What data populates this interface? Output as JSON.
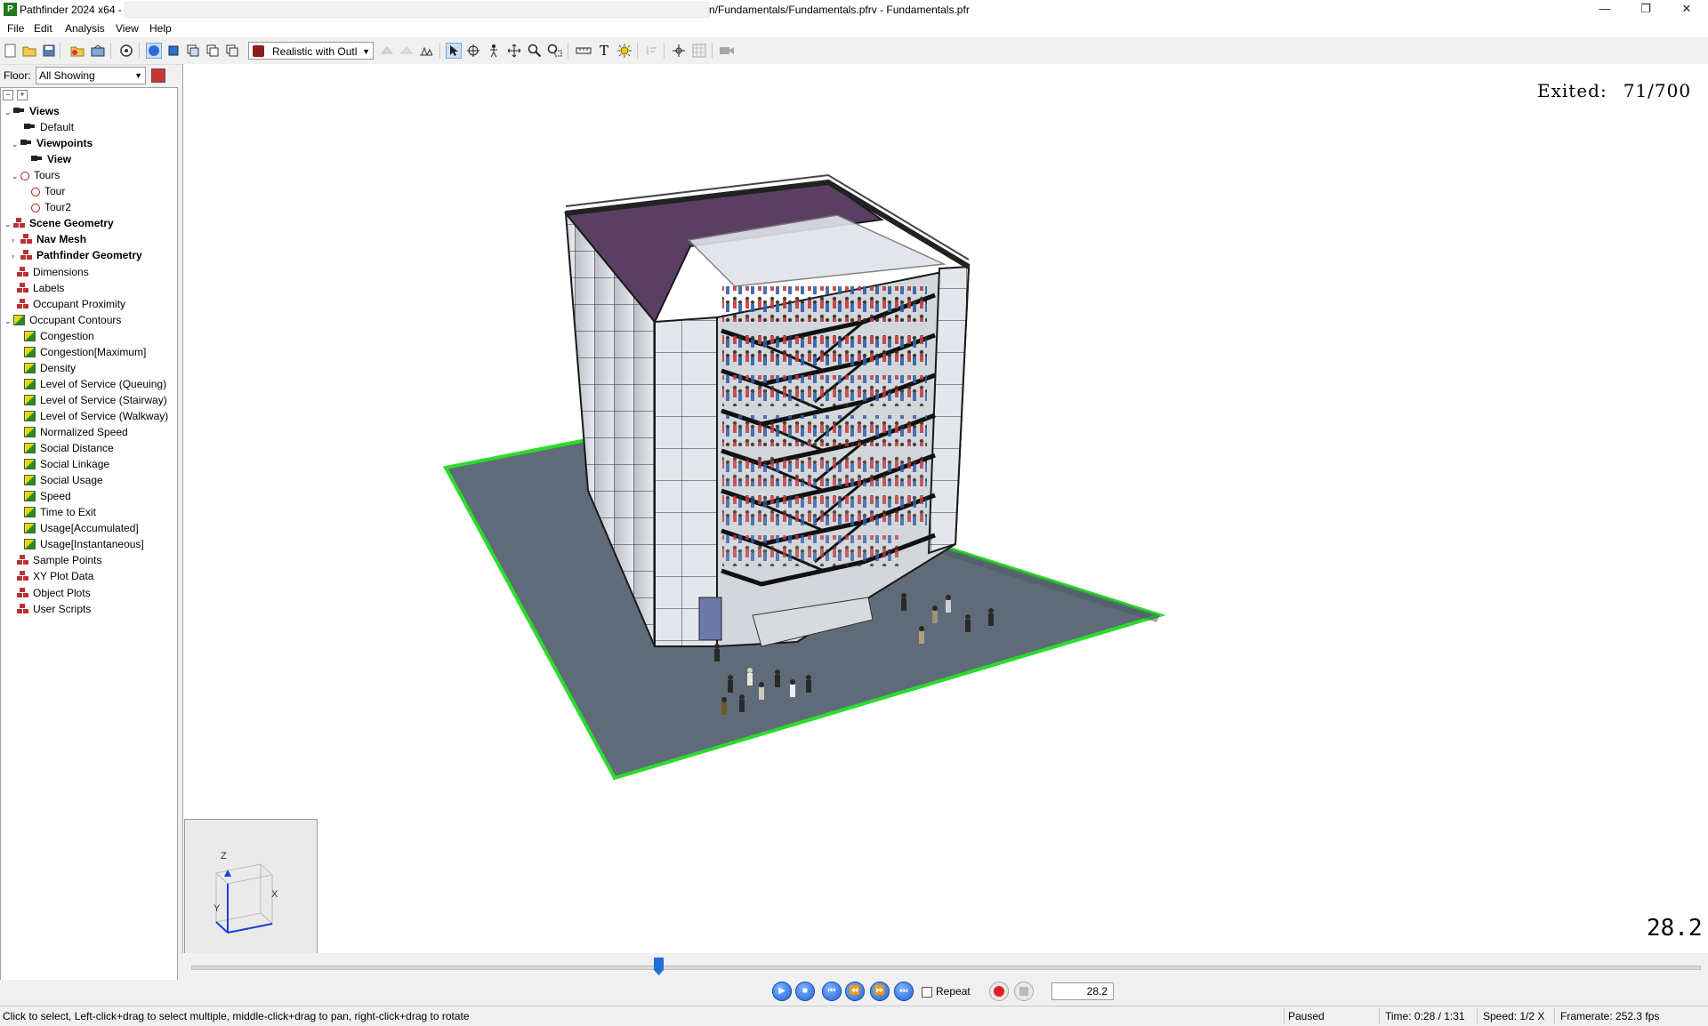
{
  "window": {
    "title_left": "Pathfinder 2024 x64 -",
    "title_right": "n/Fundamentals/Fundamentals.pfrv - Fundamentals.pfr",
    "minimize": "—",
    "maximize": "❐",
    "close": "✕"
  },
  "menu": [
    "File",
    "Edit",
    "Analysis",
    "View",
    "Help"
  ],
  "toolbar": {
    "render_mode": "Realistic with Outl"
  },
  "floor": {
    "label": "Floor:",
    "value": "All Showing"
  },
  "tree": [
    {
      "label": "Views",
      "bold": true,
      "icon": "view-icon",
      "level": 0,
      "twisty": "expanded"
    },
    {
      "label": "Default",
      "bold": false,
      "icon": "view-icon",
      "level": 1
    },
    {
      "label": "Viewpoints",
      "bold": true,
      "icon": "view-icon",
      "level": 1,
      "twisty": "expanded"
    },
    {
      "label": "View",
      "bold": true,
      "icon": "view-icon",
      "level": 2
    },
    {
      "label": "Tours",
      "bold": false,
      "icon": "tour-icon",
      "level": 1,
      "twisty": "expanded"
    },
    {
      "label": "Tour",
      "bold": false,
      "icon": "tour-icon",
      "level": 2
    },
    {
      "label": "Tour2",
      "bold": false,
      "icon": "tour-icon",
      "level": 2
    },
    {
      "label": "Scene Geometry",
      "bold": true,
      "icon": "geometry-icon",
      "level": 0,
      "twisty": "expanded"
    },
    {
      "label": "Nav Mesh",
      "bold": true,
      "icon": "geometry-icon",
      "level": 1,
      "twisty": "collapsed"
    },
    {
      "label": "Pathfinder Geometry",
      "bold": true,
      "icon": "geometry-icon",
      "level": 1,
      "twisty": "collapsed"
    },
    {
      "label": "Dimensions",
      "bold": false,
      "icon": "geometry-icon",
      "level": 0
    },
    {
      "label": "Labels",
      "bold": false,
      "icon": "geometry-icon",
      "level": 0
    },
    {
      "label": "Occupant Proximity",
      "bold": false,
      "icon": "geometry-icon",
      "level": 0
    },
    {
      "label": "Occupant Contours",
      "bold": false,
      "icon": "contour-icon",
      "level": 0,
      "twisty": "expanded"
    },
    {
      "label": "Congestion",
      "bold": false,
      "icon": "contour-icon",
      "level": 1
    },
    {
      "label": "Congestion[Maximum]",
      "bold": false,
      "icon": "contour-icon",
      "level": 1
    },
    {
      "label": "Density",
      "bold": false,
      "icon": "contour-icon",
      "level": 1
    },
    {
      "label": "Level of Service (Queuing)",
      "bold": false,
      "icon": "contour-icon",
      "level": 1
    },
    {
      "label": "Level of Service (Stairway)",
      "bold": false,
      "icon": "contour-icon",
      "level": 1
    },
    {
      "label": "Level of Service (Walkway)",
      "bold": false,
      "icon": "contour-icon",
      "level": 1
    },
    {
      "label": "Normalized Speed",
      "bold": false,
      "icon": "contour-icon",
      "level": 1
    },
    {
      "label": "Social Distance",
      "bold": false,
      "icon": "contour-icon",
      "level": 1
    },
    {
      "label": "Social Linkage",
      "bold": false,
      "icon": "contour-icon",
      "level": 1
    },
    {
      "label": "Social Usage",
      "bold": false,
      "icon": "contour-icon",
      "level": 1
    },
    {
      "label": "Speed",
      "bold": false,
      "icon": "contour-icon",
      "level": 1
    },
    {
      "label": "Time to Exit",
      "bold": false,
      "icon": "contour-icon",
      "level": 1
    },
    {
      "label": "Usage[Accumulated]",
      "bold": false,
      "icon": "contour-icon",
      "level": 1
    },
    {
      "label": "Usage[Instantaneous]",
      "bold": false,
      "icon": "contour-icon",
      "level": 1
    },
    {
      "label": "Sample Points",
      "bold": false,
      "icon": "geometry-icon",
      "level": 0
    },
    {
      "label": "XY Plot Data",
      "bold": false,
      "icon": "geometry-icon",
      "level": 0
    },
    {
      "label": "Object Plots",
      "bold": false,
      "icon": "geometry-icon",
      "level": 0
    },
    {
      "label": "User Scripts",
      "bold": false,
      "icon": "geometry-icon",
      "level": 0
    }
  ],
  "viewport": {
    "exited_label": "Exited:",
    "exited_count": "71/700",
    "current_time": "28.2",
    "axis_labels": {
      "z": "Z",
      "y": "Y",
      "x": "X"
    }
  },
  "playback": {
    "progress": 0.31,
    "repeat_label": "Repeat",
    "repeat_checked": false,
    "time_value": "28.2"
  },
  "status": {
    "hint": "Click to select, Left-click+drag to select multiple, middle-click+drag to pan, right-click+drag to rotate",
    "state": "Paused",
    "time": "Time: 0:28 / 1:31",
    "speed": "Speed: 1/2 X",
    "framerate": "Framerate: 252.3 fps"
  },
  "colors": {
    "ground": "#5f6b78",
    "ground_outline": "#2bdc2b",
    "roof": "#5a3f63",
    "facade": "#d9dde2",
    "accent_blue": "#1e6fd9"
  }
}
